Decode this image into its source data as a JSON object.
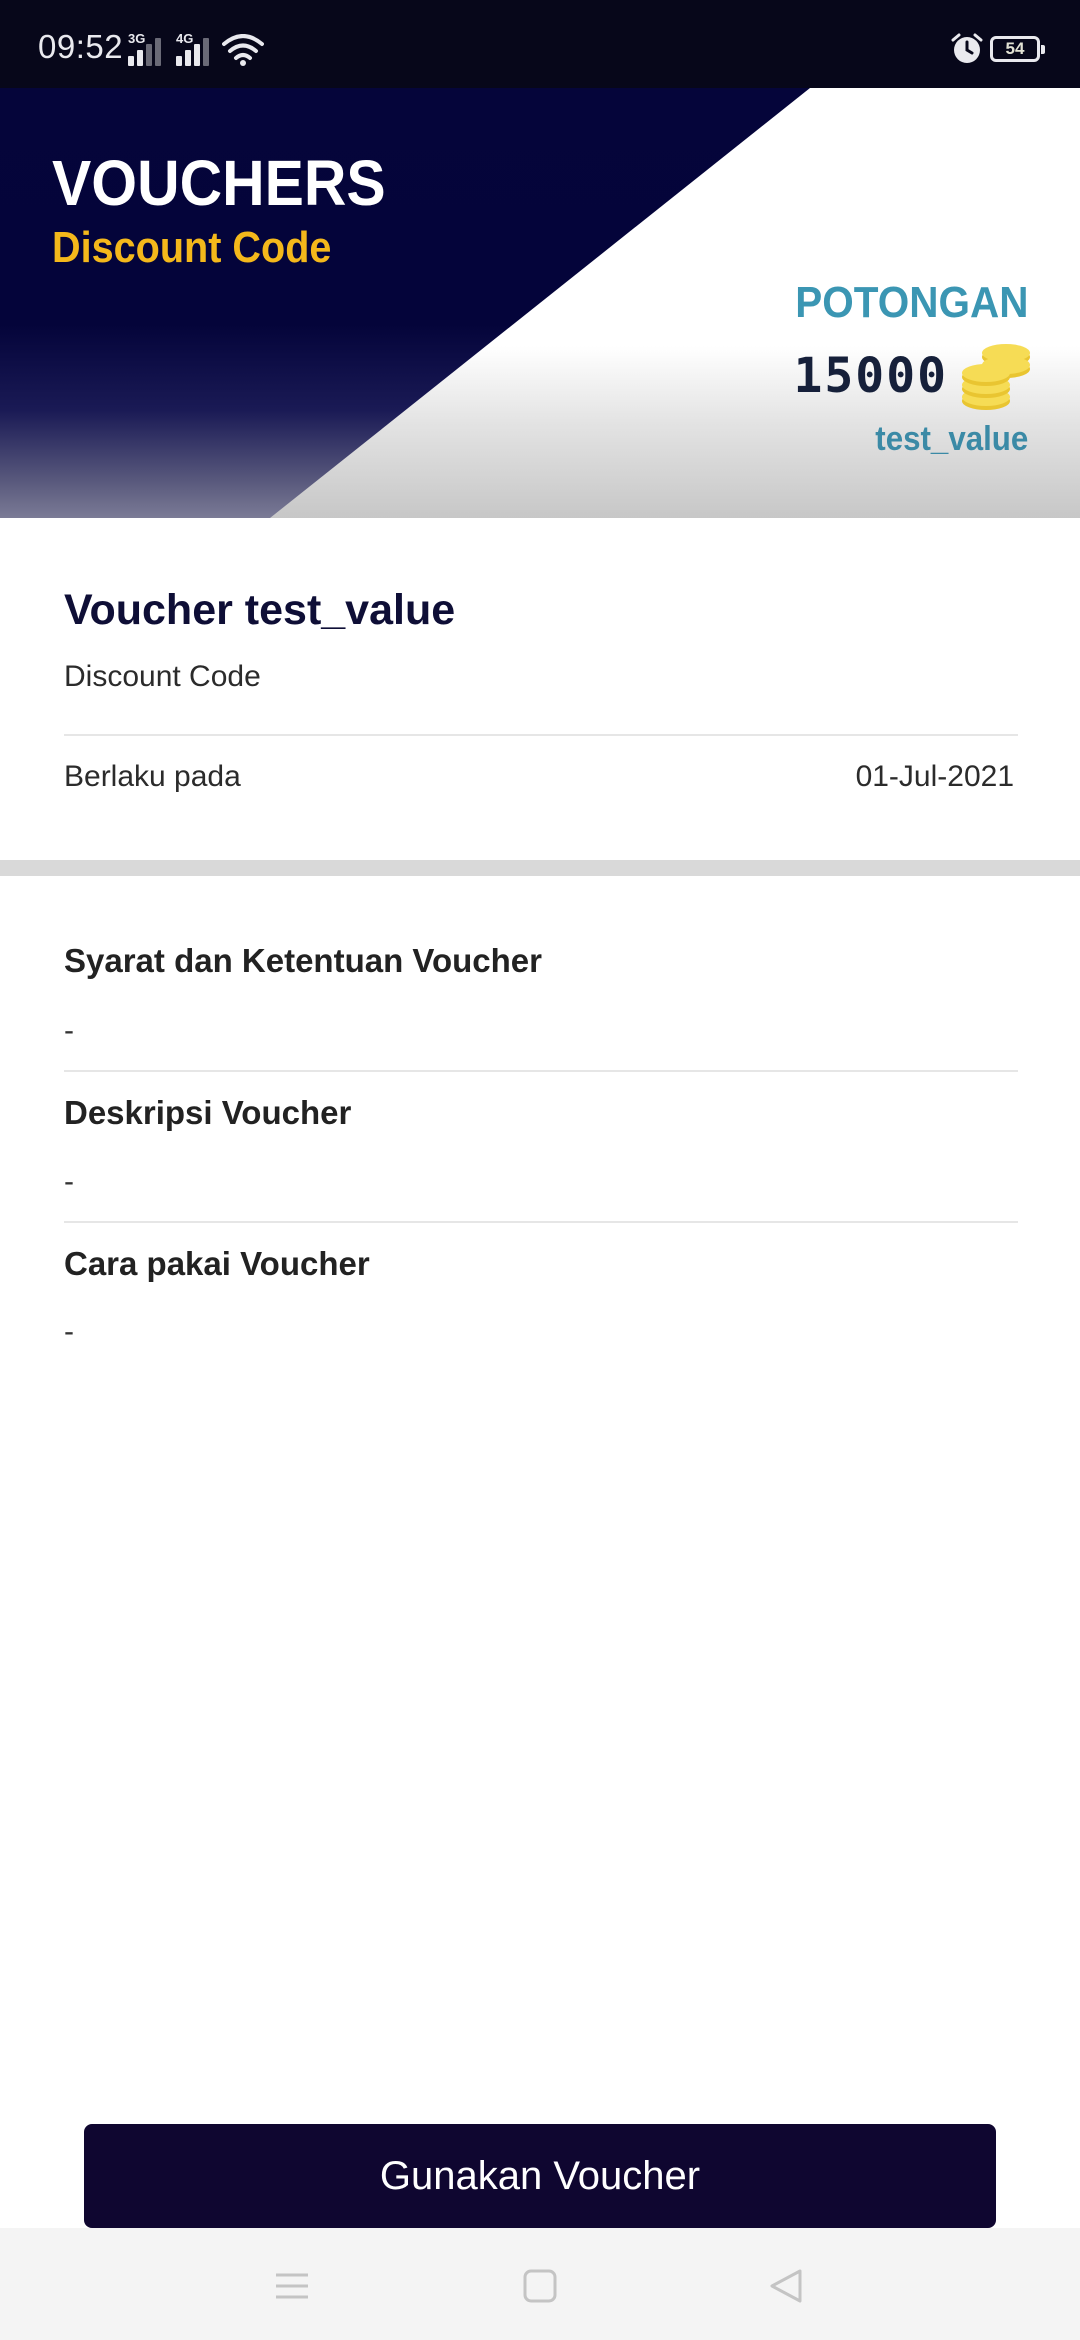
{
  "status_bar": {
    "time": "09:52",
    "signal_1_type": "3G",
    "signal_2_type": "4G",
    "battery_level": "54",
    "icons": [
      "signal-icon",
      "wifi-icon",
      "alarm-icon",
      "battery-icon"
    ]
  },
  "banner": {
    "title": "VOUCHERS",
    "subtitle": "Discount Code",
    "discount_label": "POTONGAN",
    "discount_amount": "15000",
    "voucher_code": "test_value",
    "colors": {
      "dark_bg": "#05053a",
      "subtitle": "#f4b81b",
      "accent": "#3b96b3",
      "coin": "#f2d33f"
    }
  },
  "voucher": {
    "name": "Voucher test_value",
    "type": "Discount Code",
    "valid_label": "Berlaku pada",
    "valid_date": "01-Jul-2021"
  },
  "sections": [
    {
      "title": "Syarat dan Ketentuan Voucher",
      "body": "-"
    },
    {
      "title": "Deskripsi Voucher",
      "body": "-"
    },
    {
      "title": "Cara pakai Voucher",
      "body": "-"
    }
  ],
  "action": {
    "use_label": "Gunakan Voucher",
    "color": "#0f0630"
  },
  "nav_bar": {
    "icons": [
      "menu-icon",
      "home-icon",
      "back-icon"
    ]
  }
}
